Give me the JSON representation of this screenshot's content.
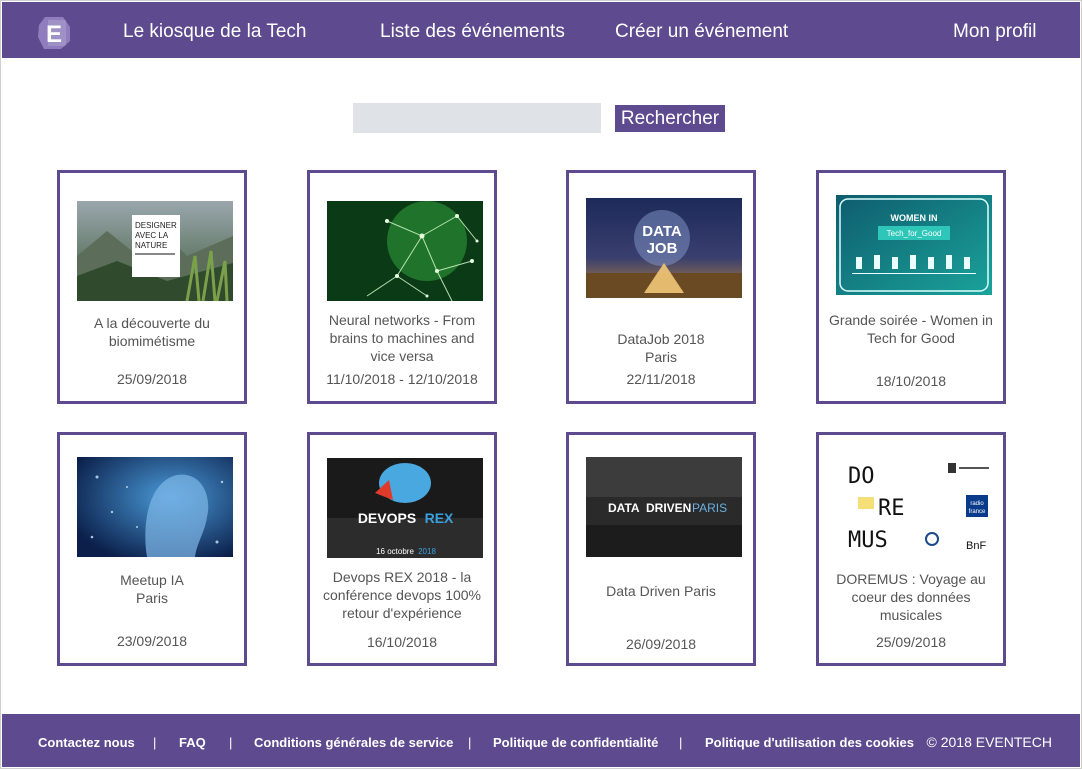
{
  "colors": {
    "brand": "#5e4a8f",
    "search_bg": "#dfe2e7",
    "text": "#555555"
  },
  "header": {
    "logo_letter": "E",
    "brand": "Le kiosque de la Tech",
    "nav_events": "Liste des événements",
    "nav_create": "Créer un événement",
    "nav_profile": "Mon profil"
  },
  "search": {
    "value": "",
    "placeholder": "",
    "button": "Rechercher"
  },
  "events": [
    {
      "title": "A la découverte du biomimétisme",
      "date": "25/09/2018",
      "image_text": [
        "DESIGNER",
        "AVEC LA",
        "NATURE"
      ]
    },
    {
      "title": "Neural networks - From brains to machines and vice versa",
      "date": "11/10/2018 - 12/10/2018"
    },
    {
      "title": "DataJob 2018",
      "subtitle": "Paris",
      "date": "22/11/2018",
      "image_text": [
        "DATA",
        "JOB"
      ]
    },
    {
      "title": "Grande soirée - Women in Tech for Good",
      "date": "18/10/2018",
      "image_text": [
        "WOMEN IN",
        "Tech_for_Good"
      ]
    },
    {
      "title": "Meetup IA",
      "subtitle": "Paris",
      "date": "23/09/2018"
    },
    {
      "title": "Devops REX 2018 - la conférence devops 100% retour d'expérience",
      "date": "16/10/2018",
      "image_text": [
        "DEVOPS",
        "REX",
        "16 octobre",
        "2018"
      ]
    },
    {
      "title": "Data Driven Paris",
      "date": "26/09/2018",
      "image_text": [
        "DATA",
        "DRIVEN",
        "PARIS"
      ]
    },
    {
      "title": "DOREMUS : Voyage au coeur des données musicales",
      "date": "25/09/2018",
      "image_text": [
        "DO",
        "RE",
        "MUS",
        "radio",
        "france",
        "BnF"
      ]
    }
  ],
  "footer": {
    "links": [
      "Contactez nous",
      "FAQ",
      "Conditions générales de service",
      "Politique de confidentialité",
      "Politique d'utilisation des cookies"
    ],
    "separator": "|",
    "copyright": "© 2018 EVENTECH"
  }
}
